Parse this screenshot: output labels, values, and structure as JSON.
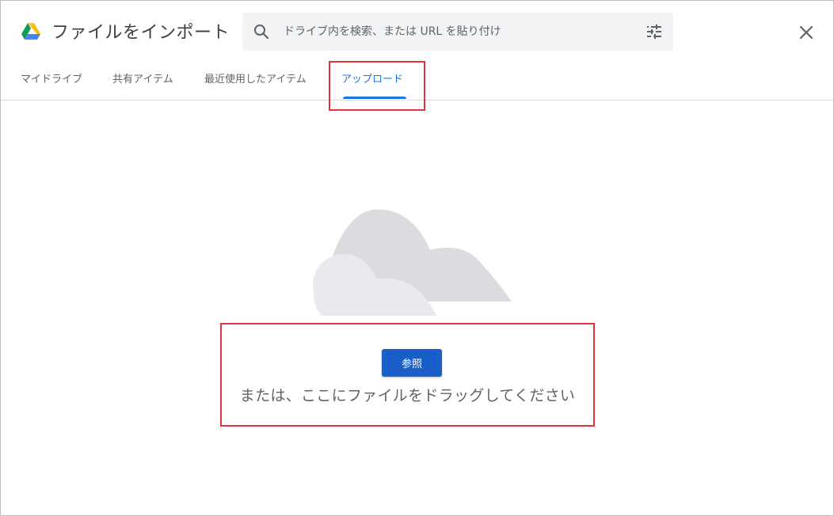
{
  "header": {
    "title": "ファイルをインポート",
    "logo_icon": "google-drive-icon",
    "search": {
      "placeholder": "ドライブ内を検索、または URL を貼り付け",
      "value": "",
      "icon": "search-icon",
      "options_icon": "tune-icon"
    },
    "close_icon": "close-icon"
  },
  "tabs": [
    {
      "label": "マイドライブ",
      "active": false
    },
    {
      "label": "共有アイテム",
      "active": false
    },
    {
      "label": "最近使用したアイテム",
      "active": false
    },
    {
      "label": "アップロード",
      "active": true
    }
  ],
  "upload": {
    "browse_label": "参照",
    "drag_text": "または、ここにファイルをドラッグしてください",
    "illustration": "cloud-illustration"
  },
  "colors": {
    "accent": "#1a73e8",
    "button": "#1a5fc9",
    "highlight": "#e8303f",
    "cloud_dark": "#dadce0",
    "cloud_light": "#e8eaed"
  }
}
